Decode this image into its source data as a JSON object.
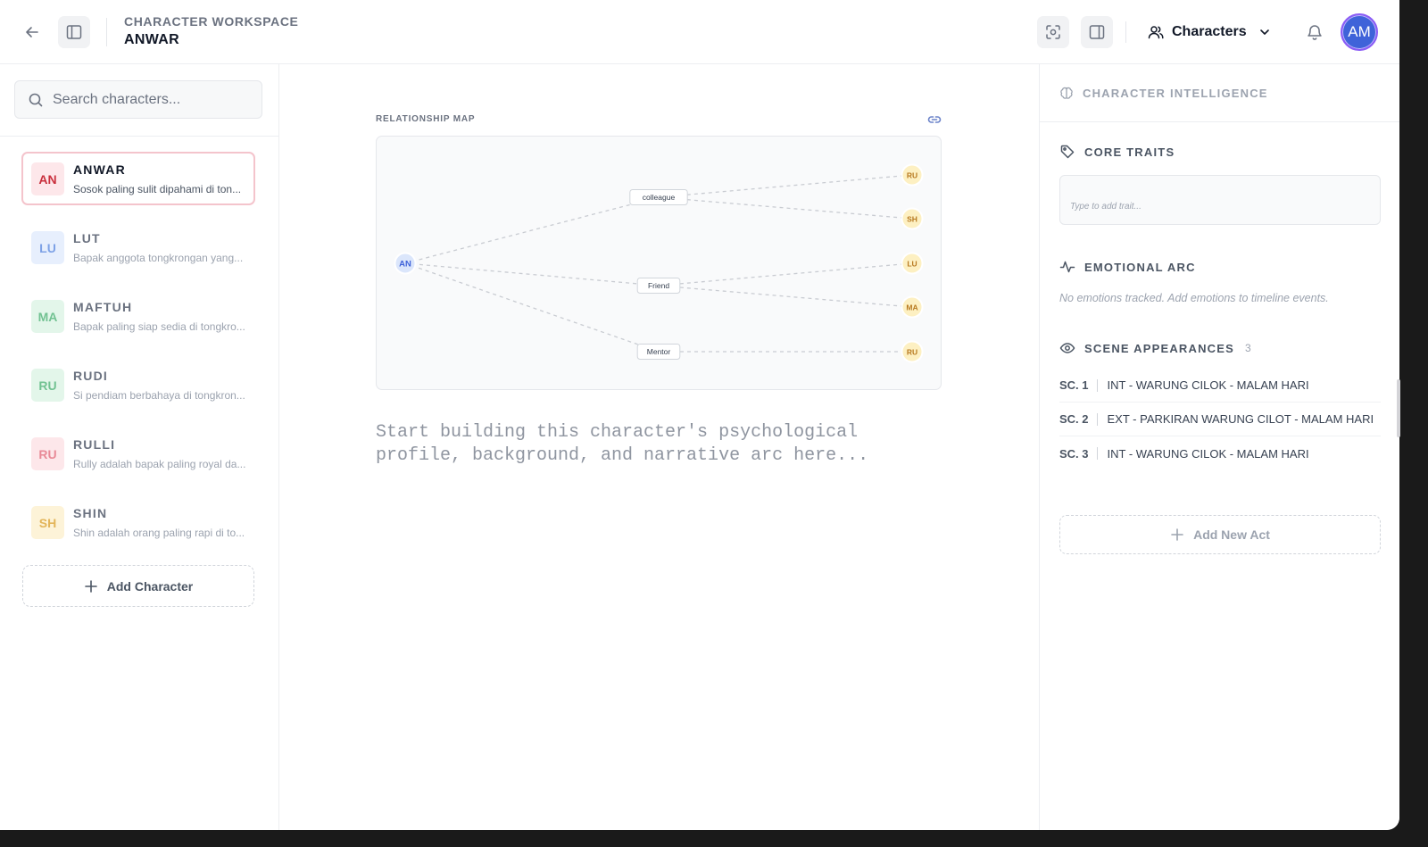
{
  "header": {
    "workspace_label": "CHARACTER WORKSPACE",
    "character_name": "ANWAR",
    "view_label": "Characters",
    "avatar_initials": "AM"
  },
  "icons": [
    "back-arrow-icon",
    "sidebar-toggle-icon",
    "focus-icon",
    "panel-icon",
    "users-icon",
    "chevron-down-icon",
    "bell-icon",
    "search-icon",
    "plus-icon",
    "link-icon",
    "brain-icon",
    "tag-icon",
    "activity-icon",
    "eye-icon"
  ],
  "sidebar": {
    "search_placeholder": "Search characters...",
    "characters": [
      {
        "initials": "AN",
        "name": "ANWAR",
        "desc": "Sosok paling sulit dipahami di ton...",
        "active": true,
        "bg": "#fde7ea",
        "fg": "#c9303d"
      },
      {
        "initials": "LU",
        "name": "LUT",
        "desc": "Bapak anggota tongkrongan yang...",
        "active": false,
        "bg": "#e7effd",
        "fg": "#7ea2e6"
      },
      {
        "initials": "MA",
        "name": "MAFTUH",
        "desc": "Bapak paling siap sedia di tongkro...",
        "active": false,
        "bg": "#e3f6ea",
        "fg": "#72c292"
      },
      {
        "initials": "RU",
        "name": "RUDI",
        "desc": "Si pendiam berbahaya di tongkron...",
        "active": false,
        "bg": "#e3f6ea",
        "fg": "#72c292"
      },
      {
        "initials": "RU",
        "name": "RULLI",
        "desc": "Rully adalah bapak paling royal da...",
        "active": false,
        "bg": "#fde7ea",
        "fg": "#e88a97"
      },
      {
        "initials": "SH",
        "name": "SHIN",
        "desc": "Shin adalah orang paling rapi di to...",
        "active": false,
        "bg": "#fdf3d8",
        "fg": "#e3b55a"
      }
    ],
    "add_character_label": "Add Character"
  },
  "center": {
    "map_label": "RELATIONSHIP MAP",
    "notes_placeholder": "Start building this character's psychological\nprofile, background, and narrative arc here..."
  },
  "relationship_map": {
    "center_node": "AN",
    "relations": [
      {
        "label": "colleague",
        "targets": [
          "RU",
          "SH"
        ]
      },
      {
        "label": "Friend",
        "targets": [
          "LU",
          "MA"
        ]
      },
      {
        "label": "Mentor",
        "targets": [
          "RU"
        ]
      }
    ]
  },
  "right_panel": {
    "title": "CHARACTER INTELLIGENCE",
    "core_traits_title": "CORE TRAITS",
    "trait_placeholder": "Type to add trait...",
    "emotional_arc_title": "EMOTIONAL ARC",
    "emotional_arc_empty": "No emotions tracked. Add emotions to timeline events.",
    "scene_appearances_title": "SCENE APPEARANCES",
    "scene_count": "3",
    "scenes": [
      {
        "num": "SC. 1",
        "heading": "INT - WARUNG CILOK - MALAM HARI"
      },
      {
        "num": "SC. 2",
        "heading": "EXT - PARKIRAN WARUNG CILOT - MALAM HARI"
      },
      {
        "num": "SC. 3",
        "heading": "INT - WARUNG CILOK - MALAM HARI"
      }
    ],
    "add_act_label": "Add New Act"
  },
  "colors": {
    "accent": "#3f63d9",
    "active_border": "#f4c4cc",
    "node_blue_bg": "#dbe6fb",
    "node_yellow_bg": "#fdf0c2",
    "node_text_orange": "#b7791f"
  }
}
